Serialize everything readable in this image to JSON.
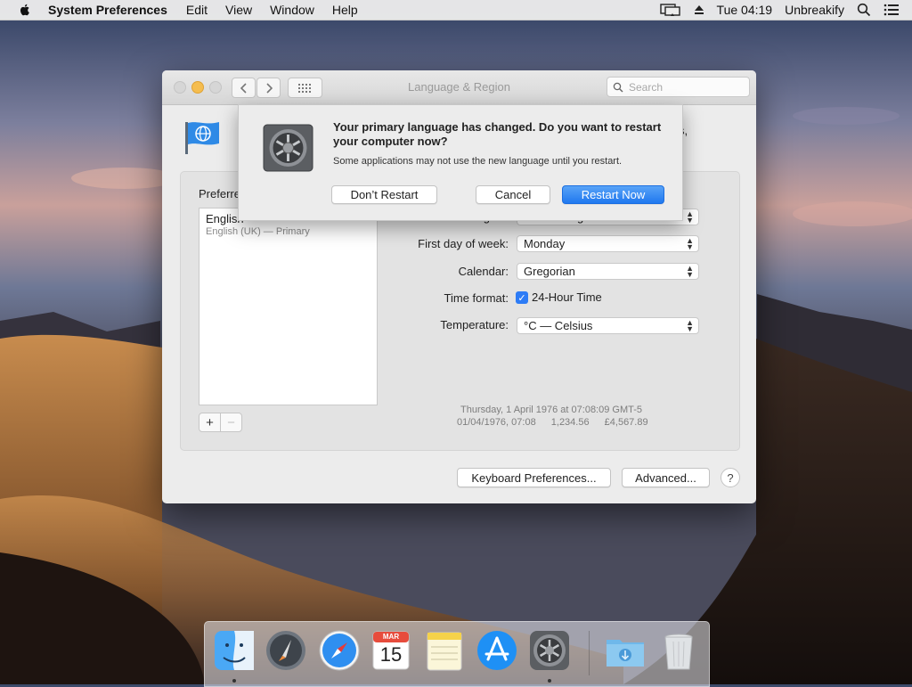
{
  "menubar": {
    "app_name": "System Preferences",
    "items": [
      "Edit",
      "View",
      "Window",
      "Help"
    ],
    "clock": "Tue 04:19",
    "user": "Unbreakify",
    "icons": [
      "apple-icon",
      "display-mirroring-icon",
      "eject-icon",
      "spotlight-icon",
      "notification-center-icon"
    ]
  },
  "window": {
    "title": "Language & Region",
    "search_placeholder": "Search",
    "preferred_label": "Preferred languages:",
    "languages": [
      {
        "name": "English",
        "detail": "English (UK) — Primary"
      }
    ],
    "settings": {
      "region": {
        "label": "Region:",
        "value": "United Kingdom"
      },
      "first_day": {
        "label": "First day of week:",
        "value": "Monday"
      },
      "calendar": {
        "label": "Calendar:",
        "value": "Gregorian"
      },
      "time_format": {
        "label": "Time format:",
        "checkbox": "24-Hour Time",
        "checked": true
      },
      "temperature": {
        "label": "Temperature:",
        "value": "°C — Celsius"
      }
    },
    "sample_date": "Thursday, 1 April 1976 at 07:08:09 GMT-5",
    "sample_short": "01/04/1976, 07:08",
    "sample_number": "1,234.56",
    "sample_currency": "£4,567.89",
    "keyboard_button": "Keyboard Preferences...",
    "advanced_button": "Advanced...",
    "help_button": "?",
    "obscured_text_right": "s,"
  },
  "alert": {
    "title": "Your primary language has changed. Do you want to restart your computer now?",
    "message": "Some applications may not use the new language until you restart.",
    "dont_restart": "Don’t Restart",
    "cancel": "Cancel",
    "restart_now": "Restart Now"
  },
  "dock": {
    "apps": [
      "Finder",
      "Launchpad",
      "Safari",
      "Calendar",
      "Notes",
      "App Store",
      "System Preferences",
      "Downloads",
      "Trash"
    ],
    "calendar_month": "MAR",
    "calendar_day": "15"
  }
}
